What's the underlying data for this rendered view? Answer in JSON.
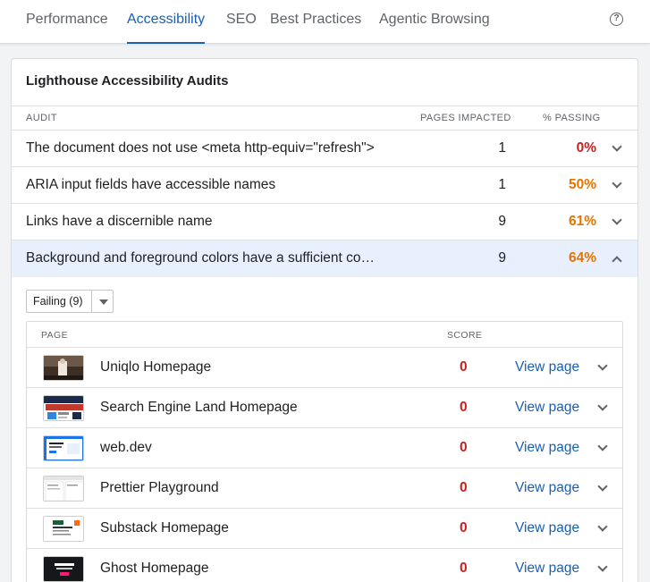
{
  "tabs": [
    {
      "label": "Performance",
      "active": false
    },
    {
      "label": "Accessibility",
      "active": true
    },
    {
      "label": "SEO",
      "active": false
    },
    {
      "label": "Best Practices",
      "active": false
    },
    {
      "label": "Agentic Browsing",
      "active": false
    }
  ],
  "help_icon": "help-circle-icon",
  "card": {
    "title": "Lighthouse Accessibility Audits",
    "columns": {
      "audit": "AUDIT",
      "pages_impacted": "PAGES IMPACTED",
      "percent_passing": "% PASSING"
    },
    "audits": [
      {
        "name": "The document does not use <meta http-equiv=\"refresh\">",
        "impacted": "1",
        "passing": "0%",
        "color": "#c5221f",
        "expanded": false
      },
      {
        "name": "ARIA input fields have accessible names",
        "impacted": "1",
        "passing": "50%",
        "color": "#e37400",
        "expanded": false
      },
      {
        "name": "Links have a discernible name",
        "impacted": "9",
        "passing": "61%",
        "color": "#e37400",
        "expanded": false
      },
      {
        "name": "Background and foreground colors have a sufficient co…",
        "impacted": "9",
        "passing": "64%",
        "color": "#e37400",
        "expanded": true
      }
    ]
  },
  "filter": {
    "label": "Failing (9)"
  },
  "pages_table": {
    "columns": {
      "page": "PAGE",
      "score": "SCORE"
    },
    "view_label": "View page",
    "rows": [
      {
        "name": "Uniqlo Homepage",
        "score": "0"
      },
      {
        "name": "Search Engine Land Homepage",
        "score": "0"
      },
      {
        "name": "web.dev",
        "score": "0"
      },
      {
        "name": "Prettier Playground",
        "score": "0"
      },
      {
        "name": "Substack Homepage",
        "score": "0"
      },
      {
        "name": "Ghost Homepage",
        "score": "0"
      }
    ]
  },
  "colors": {
    "accent": "#1a5fb4",
    "fail": "#c5221f",
    "average": "#e37400",
    "expanded_row": "#e8f0fe"
  }
}
